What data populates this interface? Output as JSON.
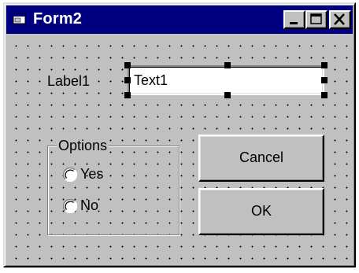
{
  "window": {
    "title": "Form2"
  },
  "form": {
    "label1": "Label1",
    "text1": "Text1",
    "options_frame": {
      "title": "Options",
      "radios": [
        {
          "label": "Yes"
        },
        {
          "label": "No"
        }
      ]
    },
    "cancel_label": "Cancel",
    "ok_label": "OK"
  }
}
